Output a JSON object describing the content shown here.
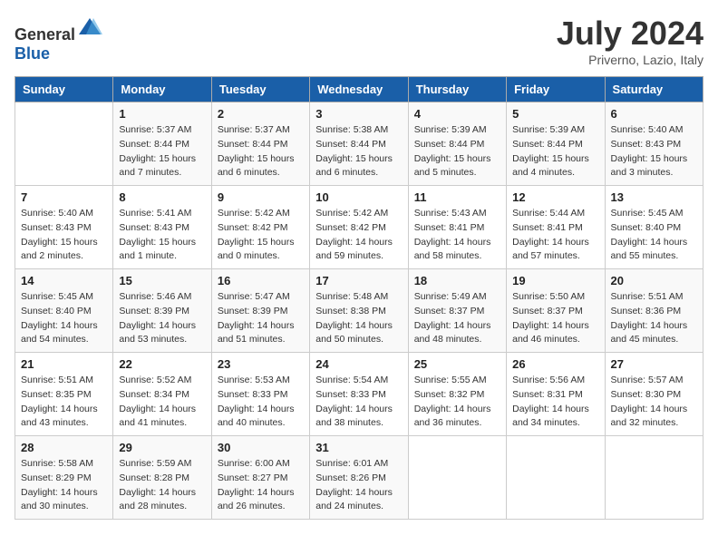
{
  "header": {
    "logo_general": "General",
    "logo_blue": "Blue",
    "month": "July 2024",
    "location": "Priverno, Lazio, Italy"
  },
  "weekdays": [
    "Sunday",
    "Monday",
    "Tuesday",
    "Wednesday",
    "Thursday",
    "Friday",
    "Saturday"
  ],
  "weeks": [
    [
      {
        "day": "",
        "sunrise": "",
        "sunset": "",
        "daylight": ""
      },
      {
        "day": "1",
        "sunrise": "Sunrise: 5:37 AM",
        "sunset": "Sunset: 8:44 PM",
        "daylight": "Daylight: 15 hours and 7 minutes."
      },
      {
        "day": "2",
        "sunrise": "Sunrise: 5:37 AM",
        "sunset": "Sunset: 8:44 PM",
        "daylight": "Daylight: 15 hours and 6 minutes."
      },
      {
        "day": "3",
        "sunrise": "Sunrise: 5:38 AM",
        "sunset": "Sunset: 8:44 PM",
        "daylight": "Daylight: 15 hours and 6 minutes."
      },
      {
        "day": "4",
        "sunrise": "Sunrise: 5:39 AM",
        "sunset": "Sunset: 8:44 PM",
        "daylight": "Daylight: 15 hours and 5 minutes."
      },
      {
        "day": "5",
        "sunrise": "Sunrise: 5:39 AM",
        "sunset": "Sunset: 8:44 PM",
        "daylight": "Daylight: 15 hours and 4 minutes."
      },
      {
        "day": "6",
        "sunrise": "Sunrise: 5:40 AM",
        "sunset": "Sunset: 8:43 PM",
        "daylight": "Daylight: 15 hours and 3 minutes."
      }
    ],
    [
      {
        "day": "7",
        "sunrise": "Sunrise: 5:40 AM",
        "sunset": "Sunset: 8:43 PM",
        "daylight": "Daylight: 15 hours and 2 minutes."
      },
      {
        "day": "8",
        "sunrise": "Sunrise: 5:41 AM",
        "sunset": "Sunset: 8:43 PM",
        "daylight": "Daylight: 15 hours and 1 minute."
      },
      {
        "day": "9",
        "sunrise": "Sunrise: 5:42 AM",
        "sunset": "Sunset: 8:42 PM",
        "daylight": "Daylight: 15 hours and 0 minutes."
      },
      {
        "day": "10",
        "sunrise": "Sunrise: 5:42 AM",
        "sunset": "Sunset: 8:42 PM",
        "daylight": "Daylight: 14 hours and 59 minutes."
      },
      {
        "day": "11",
        "sunrise": "Sunrise: 5:43 AM",
        "sunset": "Sunset: 8:41 PM",
        "daylight": "Daylight: 14 hours and 58 minutes."
      },
      {
        "day": "12",
        "sunrise": "Sunrise: 5:44 AM",
        "sunset": "Sunset: 8:41 PM",
        "daylight": "Daylight: 14 hours and 57 minutes."
      },
      {
        "day": "13",
        "sunrise": "Sunrise: 5:45 AM",
        "sunset": "Sunset: 8:40 PM",
        "daylight": "Daylight: 14 hours and 55 minutes."
      }
    ],
    [
      {
        "day": "14",
        "sunrise": "Sunrise: 5:45 AM",
        "sunset": "Sunset: 8:40 PM",
        "daylight": "Daylight: 14 hours and 54 minutes."
      },
      {
        "day": "15",
        "sunrise": "Sunrise: 5:46 AM",
        "sunset": "Sunset: 8:39 PM",
        "daylight": "Daylight: 14 hours and 53 minutes."
      },
      {
        "day": "16",
        "sunrise": "Sunrise: 5:47 AM",
        "sunset": "Sunset: 8:39 PM",
        "daylight": "Daylight: 14 hours and 51 minutes."
      },
      {
        "day": "17",
        "sunrise": "Sunrise: 5:48 AM",
        "sunset": "Sunset: 8:38 PM",
        "daylight": "Daylight: 14 hours and 50 minutes."
      },
      {
        "day": "18",
        "sunrise": "Sunrise: 5:49 AM",
        "sunset": "Sunset: 8:37 PM",
        "daylight": "Daylight: 14 hours and 48 minutes."
      },
      {
        "day": "19",
        "sunrise": "Sunrise: 5:50 AM",
        "sunset": "Sunset: 8:37 PM",
        "daylight": "Daylight: 14 hours and 46 minutes."
      },
      {
        "day": "20",
        "sunrise": "Sunrise: 5:51 AM",
        "sunset": "Sunset: 8:36 PM",
        "daylight": "Daylight: 14 hours and 45 minutes."
      }
    ],
    [
      {
        "day": "21",
        "sunrise": "Sunrise: 5:51 AM",
        "sunset": "Sunset: 8:35 PM",
        "daylight": "Daylight: 14 hours and 43 minutes."
      },
      {
        "day": "22",
        "sunrise": "Sunrise: 5:52 AM",
        "sunset": "Sunset: 8:34 PM",
        "daylight": "Daylight: 14 hours and 41 minutes."
      },
      {
        "day": "23",
        "sunrise": "Sunrise: 5:53 AM",
        "sunset": "Sunset: 8:33 PM",
        "daylight": "Daylight: 14 hours and 40 minutes."
      },
      {
        "day": "24",
        "sunrise": "Sunrise: 5:54 AM",
        "sunset": "Sunset: 8:33 PM",
        "daylight": "Daylight: 14 hours and 38 minutes."
      },
      {
        "day": "25",
        "sunrise": "Sunrise: 5:55 AM",
        "sunset": "Sunset: 8:32 PM",
        "daylight": "Daylight: 14 hours and 36 minutes."
      },
      {
        "day": "26",
        "sunrise": "Sunrise: 5:56 AM",
        "sunset": "Sunset: 8:31 PM",
        "daylight": "Daylight: 14 hours and 34 minutes."
      },
      {
        "day": "27",
        "sunrise": "Sunrise: 5:57 AM",
        "sunset": "Sunset: 8:30 PM",
        "daylight": "Daylight: 14 hours and 32 minutes."
      }
    ],
    [
      {
        "day": "28",
        "sunrise": "Sunrise: 5:58 AM",
        "sunset": "Sunset: 8:29 PM",
        "daylight": "Daylight: 14 hours and 30 minutes."
      },
      {
        "day": "29",
        "sunrise": "Sunrise: 5:59 AM",
        "sunset": "Sunset: 8:28 PM",
        "daylight": "Daylight: 14 hours and 28 minutes."
      },
      {
        "day": "30",
        "sunrise": "Sunrise: 6:00 AM",
        "sunset": "Sunset: 8:27 PM",
        "daylight": "Daylight: 14 hours and 26 minutes."
      },
      {
        "day": "31",
        "sunrise": "Sunrise: 6:01 AM",
        "sunset": "Sunset: 8:26 PM",
        "daylight": "Daylight: 14 hours and 24 minutes."
      },
      {
        "day": "",
        "sunrise": "",
        "sunset": "",
        "daylight": ""
      },
      {
        "day": "",
        "sunrise": "",
        "sunset": "",
        "daylight": ""
      },
      {
        "day": "",
        "sunrise": "",
        "sunset": "",
        "daylight": ""
      }
    ]
  ]
}
